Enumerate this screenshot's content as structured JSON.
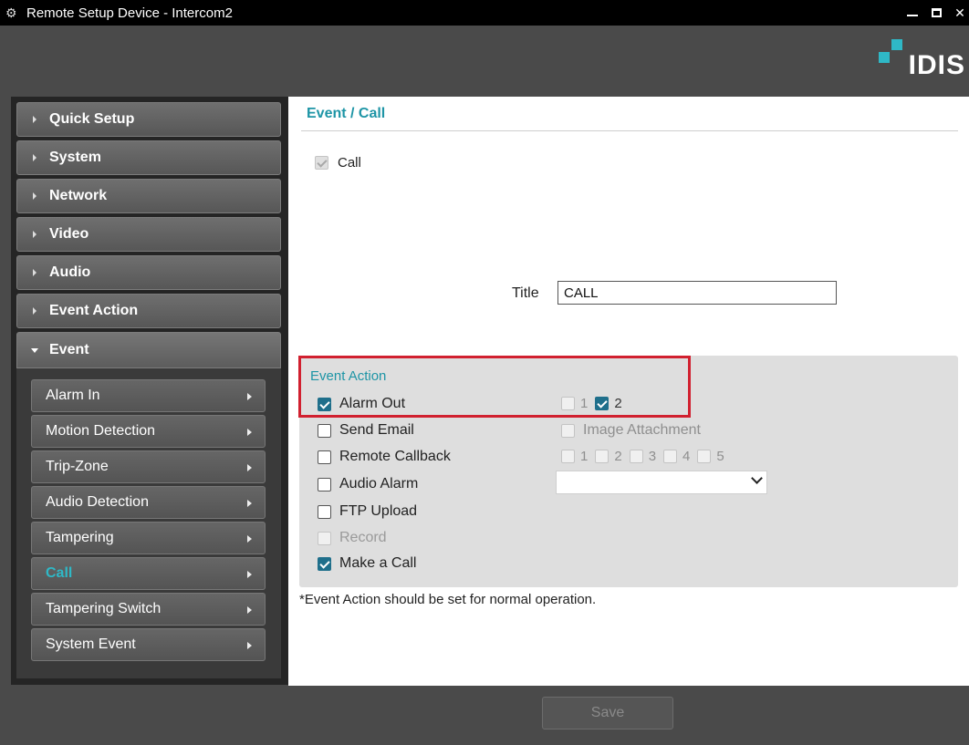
{
  "window": {
    "title": "Remote Setup Device - Intercom2",
    "app_icon": "gear-icon",
    "controls": [
      "minimize-icon",
      "maximize-icon",
      "close-icon"
    ]
  },
  "brand": {
    "logo_text": "IDIS",
    "accent": "#2fb8c6"
  },
  "sidebar": {
    "menu": [
      {
        "label": "Quick Setup"
      },
      {
        "label": "System"
      },
      {
        "label": "Network"
      },
      {
        "label": "Video"
      },
      {
        "label": "Audio"
      },
      {
        "label": "Event Action"
      },
      {
        "label": "Event",
        "expanded": true
      }
    ],
    "submenu": [
      {
        "label": "Alarm In"
      },
      {
        "label": "Motion Detection"
      },
      {
        "label": "Trip-Zone"
      },
      {
        "label": "Audio Detection"
      },
      {
        "label": "Tampering"
      },
      {
        "label": "Call",
        "active": true
      },
      {
        "label": "Tampering Switch"
      },
      {
        "label": "System Event"
      }
    ]
  },
  "main": {
    "page_title": "Event / Call",
    "call": {
      "label": "Call",
      "checked": true,
      "disabled": true
    },
    "title_field": {
      "label": "Title",
      "value": "CALL"
    },
    "event_action": {
      "heading": "Event Action",
      "alarm_out": {
        "label": "Alarm Out",
        "checked": true,
        "options": [
          {
            "num": "1",
            "checked": false,
            "disabled": true
          },
          {
            "num": "2",
            "checked": true
          }
        ]
      },
      "send_email": {
        "label": "Send Email",
        "checked": false,
        "attachment_label": "Image Attachment"
      },
      "remote_callback": {
        "label": "Remote Callback",
        "checked": false,
        "options": [
          "1",
          "2",
          "3",
          "4",
          "5"
        ]
      },
      "audio_alarm": {
        "label": "Audio Alarm",
        "checked": false,
        "select_value": ""
      },
      "ftp_upload": {
        "label": "FTP Upload",
        "checked": false
      },
      "record": {
        "label": "Record",
        "checked": false,
        "disabled": true
      },
      "make_a_call": {
        "label": "Make a Call",
        "checked": true
      }
    },
    "note": "*Event Action should be set for normal operation."
  },
  "footer": {
    "save_label": "Save"
  },
  "colors": {
    "highlight_border": "#d1202f",
    "checkbox_checked": "#1f6f8b",
    "title_color": "#1e95a6"
  }
}
